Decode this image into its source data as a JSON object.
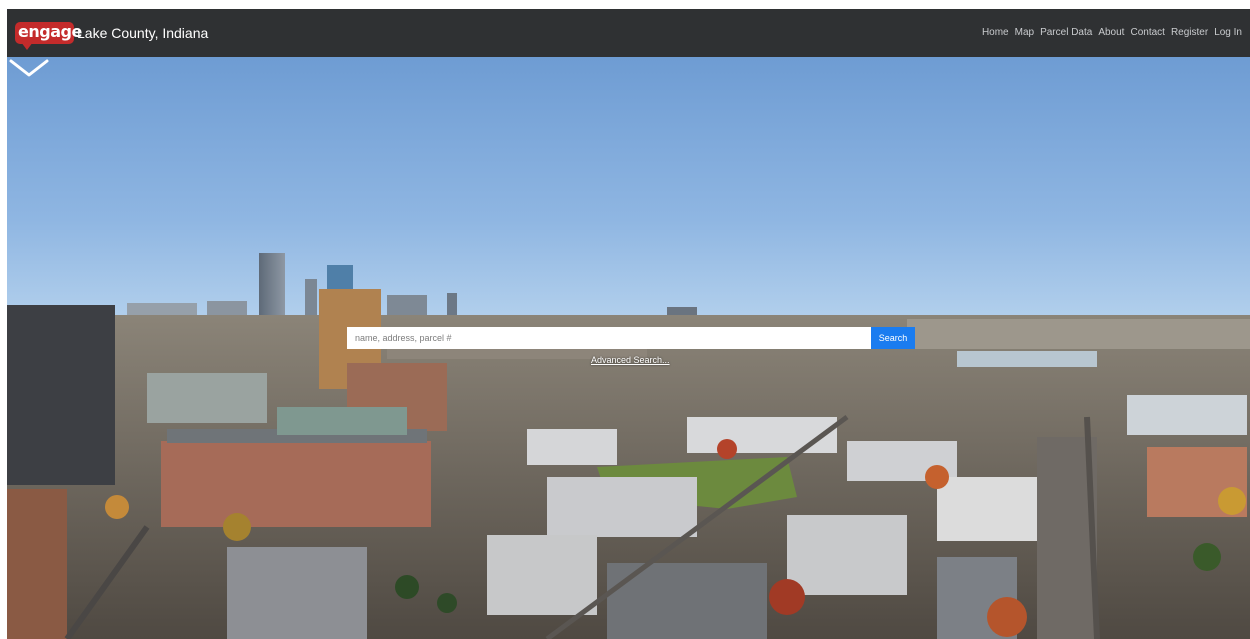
{
  "brand": {
    "logo_text": "engage",
    "name": "Lake County, Indiana"
  },
  "nav": {
    "items": [
      "Home",
      "Map",
      "Parcel Data",
      "About",
      "Contact",
      "Register",
      "Log In"
    ]
  },
  "search": {
    "placeholder": "name, address, parcel #",
    "value": "",
    "button_label": "Search",
    "advanced_link": "Advanced Search..."
  },
  "icons": {
    "scroll": "chevron-down-icon",
    "logo": "engage-logo"
  },
  "colors": {
    "navbar": "#2f3133",
    "logo": "#c42b2b",
    "search_button": "#1a7cf0"
  }
}
